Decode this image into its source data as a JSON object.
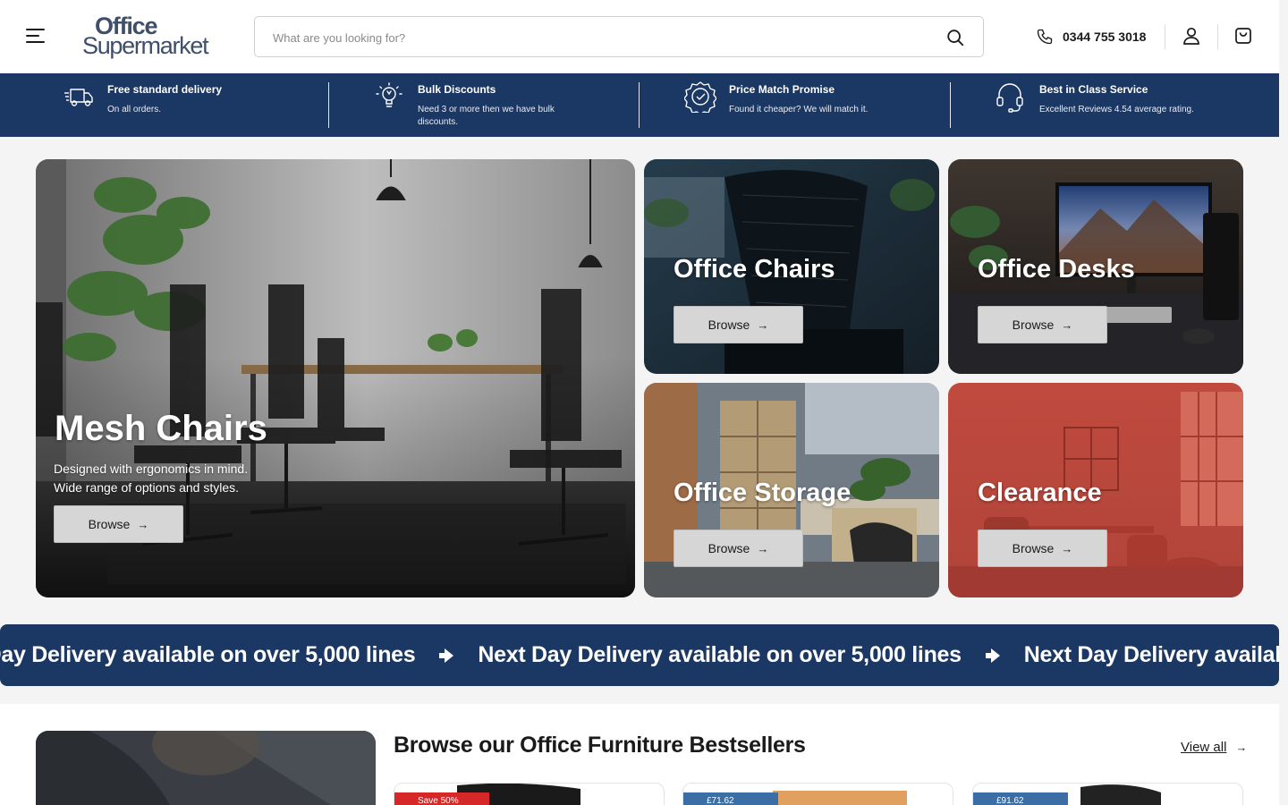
{
  "header": {
    "logo_line1": "Office",
    "logo_line2": "Supermarket",
    "search_placeholder": "What are you looking for?",
    "phone": "0344 755 3018"
  },
  "usp": [
    {
      "title": "Free standard delivery",
      "subtitle": "On all orders.",
      "icon": "delivery-truck-icon"
    },
    {
      "title": "Bulk Discounts",
      "subtitle": "Need 3 or more then we have bulk discounts.",
      "icon": "lightbulb-icon"
    },
    {
      "title": "Price Match Promise",
      "subtitle": "Found it cheaper? We will match it.",
      "icon": "check-badge-icon"
    },
    {
      "title": "Best in Class Service",
      "subtitle": "Excellent Reviews 4.54 average rating.",
      "icon": "headset-icon"
    }
  ],
  "tiles": {
    "mesh": {
      "title": "Mesh Chairs",
      "desc_line1": "Designed with ergonomics in mind.",
      "desc_line2": "Wide range of options and styles.",
      "button": "Browse"
    },
    "chairs": {
      "title": "Office Chairs",
      "button": "Browse"
    },
    "desks": {
      "title": "Office Desks",
      "button": "Browse"
    },
    "storage": {
      "title": "Office Storage",
      "button": "Browse"
    },
    "clearance": {
      "title": "Clearance",
      "button": "Browse"
    }
  },
  "marquee": {
    "text": "Next Day Delivery available on over 5,000 lines"
  },
  "bestsellers": {
    "title": "Browse our Office Furniture Bestsellers",
    "view_all": "View all",
    "cards": [
      {
        "badge": "Save 50%",
        "badge_color": "#d62828"
      },
      {
        "badge": "£71.62",
        "badge_color": "#3a6ea5"
      },
      {
        "badge": "£91.62",
        "badge_color": "#3a6ea5"
      }
    ]
  },
  "colors": {
    "navy": "#1b3763",
    "page_bg": "#f4f4f4",
    "button_grey": "#d6d6d6"
  }
}
